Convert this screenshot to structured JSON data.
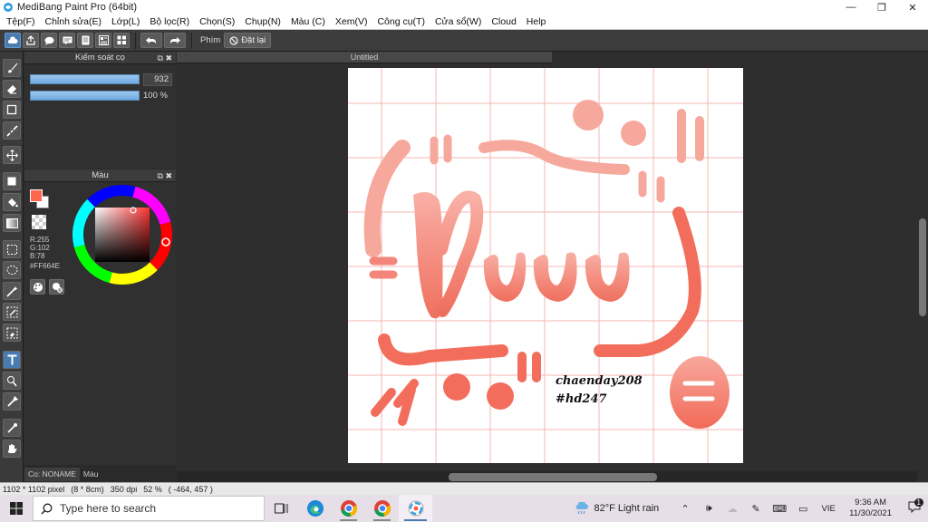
{
  "window": {
    "title": "MediBang Paint Pro (64bit)",
    "minimize": "—",
    "restore": "❐",
    "close": "✕"
  },
  "menu": [
    "Tệp(F)",
    "Chỉnh sửa(E)",
    "Lớp(L)",
    "Bộ lọc(R)",
    "Chọn(S)",
    "Chụp(N)",
    "Màu (C)",
    "Xem(V)",
    "Công cụ(T)",
    "Cửa sổ(W)",
    "Cloud",
    "Help"
  ],
  "toolbar": {
    "shortcut_label": "Phím",
    "reset_label": "Đặt lại"
  },
  "brush_panel": {
    "title": "Kiểm soát cọ",
    "size_value": "932",
    "opacity_value": "100 %",
    "size_fill": 1.0,
    "opacity_fill": 1.0
  },
  "color_panel": {
    "title": "Màu",
    "r": "R:255",
    "g": "G:102",
    "b": "B:78",
    "hex": "#FF664E",
    "current_color": "#ff664e"
  },
  "bottom_tabs": {
    "brush_name": "Co: NONAME",
    "color": "Màu"
  },
  "document": {
    "tab_title": "Untitled",
    "text_line1": "chaenday208",
    "text_line2": "#hd247"
  },
  "status": {
    "size": "1102 * 1102 pixel",
    "cm": "(8 * 8cm)",
    "dpi": "350 dpi",
    "zoom": "52 %",
    "coords": "( -464, 457 )"
  },
  "taskbar": {
    "search_placeholder": "Type here to search",
    "weather": "82°F  Light rain",
    "lang": "VIE",
    "time": "9:36 AM",
    "date": "11/30/2021",
    "notifications": "1"
  },
  "colors": {
    "accent": "#ff664e",
    "lettering_light": "#f7a59b",
    "lettering_dark": "#ef6a5a",
    "grid": "#f4b7b0"
  }
}
